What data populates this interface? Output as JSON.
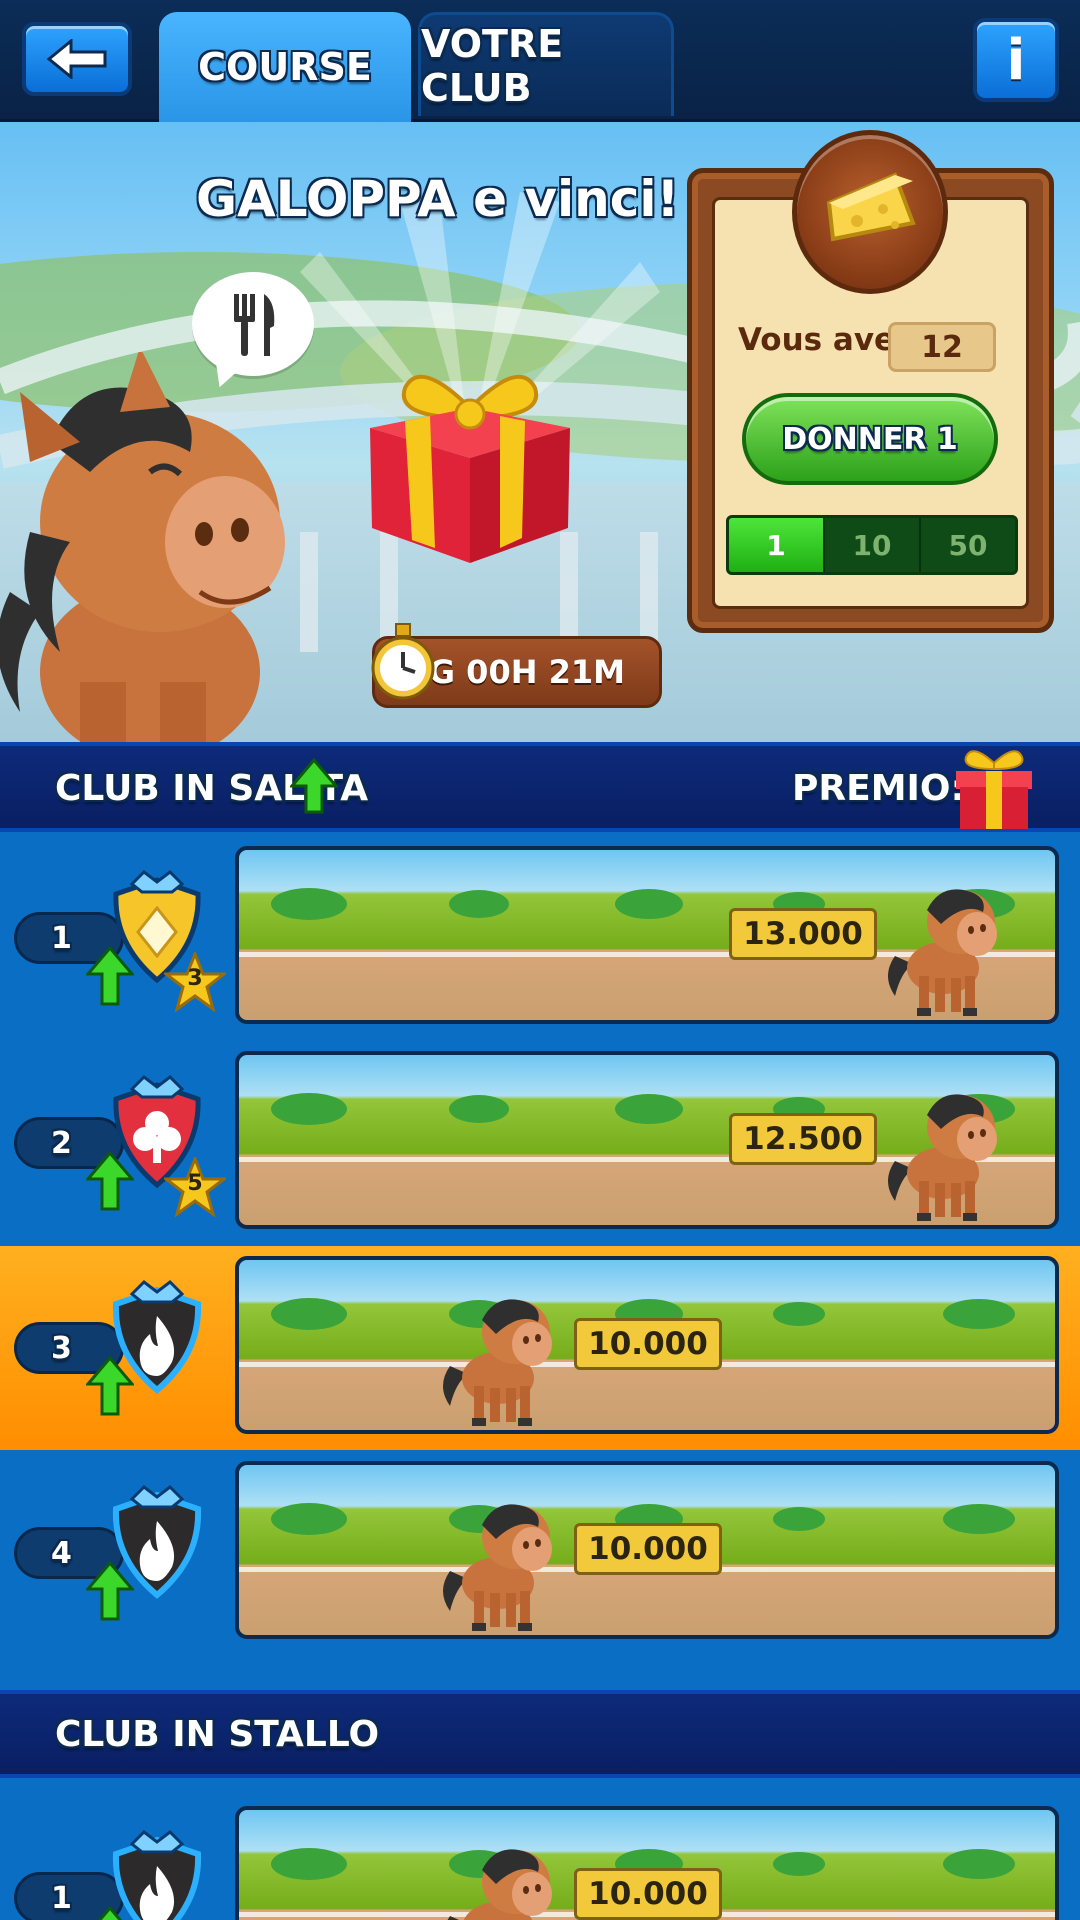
{
  "nav": {
    "back_icon": "arrow-left-icon",
    "tabs": [
      {
        "label": "COURSE",
        "active": true
      },
      {
        "label": "VOTRE CLUB",
        "active": false
      }
    ],
    "info_label": "i"
  },
  "hero": {
    "title": "GALOPPA e vinci!",
    "speech_icon": "fork-knife-icon",
    "timer": "04G 00H 21M"
  },
  "board": {
    "you_have_label": "Vous avez :",
    "you_have_value": "12",
    "donate_button": "DONNER 1",
    "quantities": [
      {
        "label": "1",
        "active": true
      },
      {
        "label": "10",
        "active": false
      },
      {
        "label": "50",
        "active": false
      }
    ]
  },
  "sections": {
    "rising": {
      "title": "CLUB IN SALITA",
      "prize_label": "PREMIO:"
    },
    "stalled": {
      "title": "CLUB IN STALLO"
    }
  },
  "rising_rows": [
    {
      "rank": "1",
      "badge": "diamond-badge",
      "stars": "3",
      "score": "13.000",
      "progress": 0.92,
      "highlight": false
    },
    {
      "rank": "2",
      "badge": "club-badge",
      "stars": "5",
      "score": "12.500",
      "progress": 0.92,
      "highlight": false
    },
    {
      "rank": "3",
      "badge": "fire-badge",
      "stars": "",
      "score": "10.000",
      "progress": 0.38,
      "highlight": true
    },
    {
      "rank": "4",
      "badge": "fire-badge",
      "stars": "",
      "score": "10.000",
      "progress": 0.38,
      "highlight": false
    }
  ],
  "stalled_rows": [
    {
      "rank": "1",
      "badge": "fire-badge",
      "stars": "",
      "score": "10.000",
      "progress": 0.38,
      "highlight": false
    }
  ],
  "colors": {
    "accent_blue": "#2a95e6",
    "highlight_orange": "#ff9f0a",
    "green_button": "#2ca11a",
    "score_yellow": "#f1c93a"
  }
}
